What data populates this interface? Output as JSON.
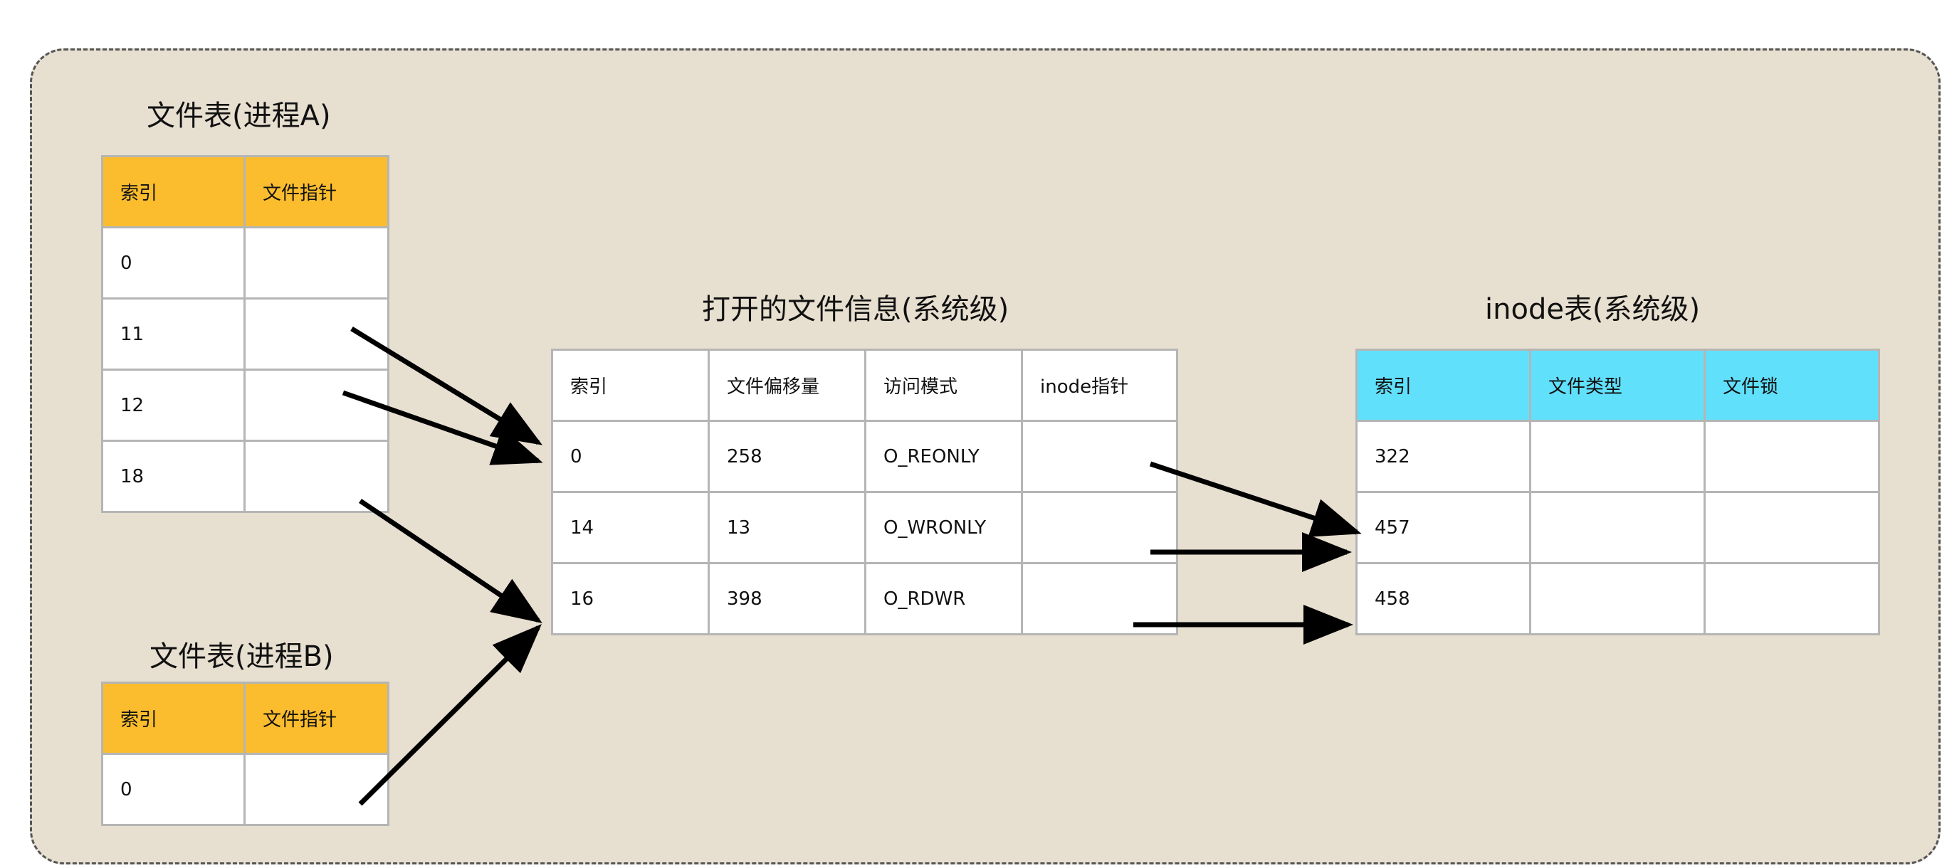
{
  "colors": {
    "panel_bg": "#e7dfd0",
    "header_orange": "#fbbd2e",
    "header_cyan": "#61e0fc",
    "arrow": "#000000"
  },
  "proc_a": {
    "title": "文件表(进程A)",
    "headers": [
      "索引",
      "文件指针"
    ],
    "rows": [
      [
        "0",
        ""
      ],
      [
        "11",
        ""
      ],
      [
        "12",
        ""
      ],
      [
        "18",
        ""
      ]
    ]
  },
  "proc_b": {
    "title": "文件表(进程B)",
    "headers": [
      "索引",
      "文件指针"
    ],
    "rows": [
      [
        "0",
        ""
      ]
    ]
  },
  "open_files": {
    "title": "打开的文件信息(系统级)",
    "headers": [
      "索引",
      "文件偏移量",
      "访问模式",
      "inode指针"
    ],
    "rows": [
      [
        "0",
        "258",
        "O_REONLY",
        ""
      ],
      [
        "14",
        "13",
        "O_WRONLY",
        ""
      ],
      [
        "16",
        "398",
        "O_RDWR",
        ""
      ]
    ]
  },
  "inode": {
    "title": "inode表(系统级)",
    "headers": [
      "索引",
      "文件类型",
      "文件锁"
    ],
    "rows": [
      [
        "322",
        "",
        ""
      ],
      [
        "457",
        "",
        ""
      ],
      [
        "458",
        "",
        ""
      ]
    ]
  }
}
